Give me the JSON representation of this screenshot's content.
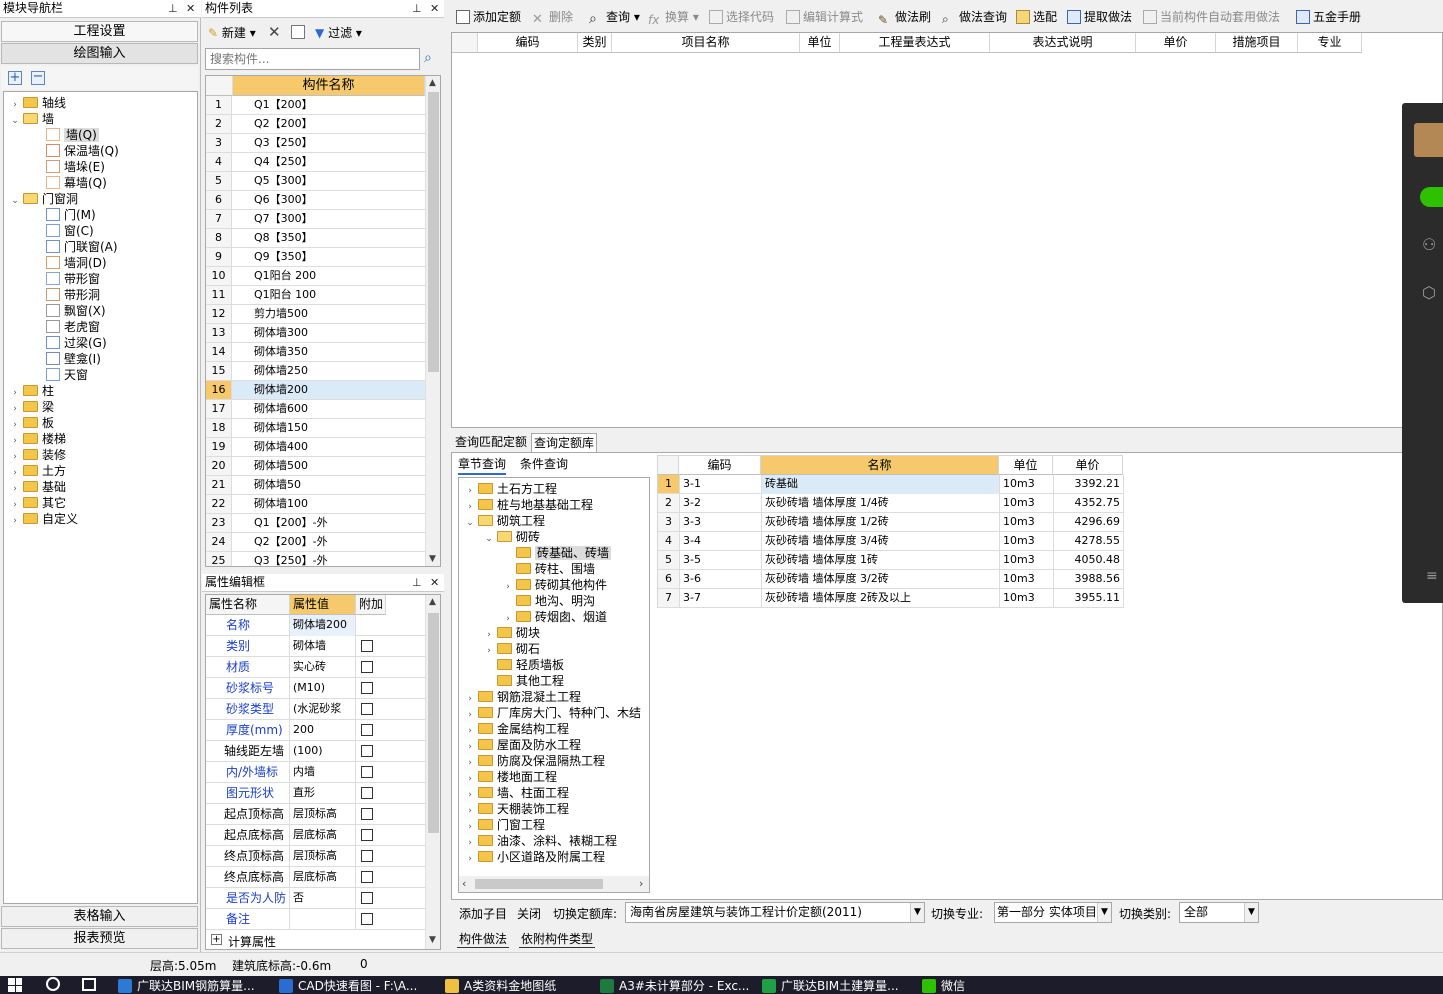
{
  "nav": {
    "title": "模块导航栏",
    "project_settings": "工程设置",
    "drawing_input": "绘图输入",
    "table_input": "表格输入",
    "report_preview": "报表预览",
    "tree": [
      {
        "label": "轴线",
        "level": 0,
        "arrow": "›",
        "open": false
      },
      {
        "label": "墙",
        "level": 0,
        "arrow": "⌄",
        "open": true
      },
      {
        "label": "墙(Q)",
        "level": 1,
        "icon": "wall",
        "selected": true
      },
      {
        "label": "保温墙(Q)",
        "level": 1,
        "icon": "insul"
      },
      {
        "label": "墙垛(E)",
        "level": 1,
        "icon": "pier"
      },
      {
        "label": "幕墙(Q)",
        "level": 1,
        "icon": "curtain"
      },
      {
        "label": "门窗洞",
        "level": 0,
        "arrow": "⌄",
        "open": true
      },
      {
        "label": "门(M)",
        "level": 1,
        "icon": "door"
      },
      {
        "label": "窗(C)",
        "level": 1,
        "icon": "window"
      },
      {
        "label": "门联窗(A)",
        "level": 1,
        "icon": "doorwin"
      },
      {
        "label": "墙洞(D)",
        "level": 1,
        "icon": "hole"
      },
      {
        "label": "带形窗",
        "level": 1,
        "icon": "stripwin"
      },
      {
        "label": "带形洞",
        "level": 1,
        "icon": "striphole"
      },
      {
        "label": "飘窗(X)",
        "level": 1,
        "icon": "baywin"
      },
      {
        "label": "老虎窗",
        "level": 1,
        "icon": "dormer"
      },
      {
        "label": "过梁(G)",
        "level": 1,
        "icon": "lintel"
      },
      {
        "label": "壁龛(I)",
        "level": 1,
        "icon": "niche"
      },
      {
        "label": "天窗",
        "level": 1,
        "icon": "skylight"
      },
      {
        "label": "柱",
        "level": 0,
        "arrow": "›"
      },
      {
        "label": "梁",
        "level": 0,
        "arrow": "›"
      },
      {
        "label": "板",
        "level": 0,
        "arrow": "›"
      },
      {
        "label": "楼梯",
        "level": 0,
        "arrow": "›"
      },
      {
        "label": "装修",
        "level": 0,
        "arrow": "›"
      },
      {
        "label": "土方",
        "level": 0,
        "arrow": "›"
      },
      {
        "label": "基础",
        "level": 0,
        "arrow": "›"
      },
      {
        "label": "其它",
        "level": 0,
        "arrow": "›"
      },
      {
        "label": "自定义",
        "level": 0,
        "arrow": "›"
      }
    ]
  },
  "component_list": {
    "title": "构件列表",
    "new_label": "新建",
    "filter_label": "过滤",
    "search_placeholder": "搜索构件...",
    "col_name": "构件名称",
    "rows": [
      "Q1【200】",
      "Q2【200】",
      "Q3【250】",
      "Q4【250】",
      "Q5【300】",
      "Q6【300】",
      "Q7【300】",
      "Q8【350】",
      "Q9【350】",
      "Q1阳台 200",
      "Q1阳台 100",
      "剪力墙500",
      "砌体墙300",
      "砌体墙350",
      "砌体墙250",
      "砌体墙200",
      "砌体墙600",
      "砌体墙150",
      "砌体墙400",
      "砌体墙500",
      "砌体墙50",
      "砌体墙100",
      "Q1【200】-外",
      "Q2【200】-外",
      "Q3【250】-外"
    ],
    "selected_index": 16
  },
  "properties": {
    "title": "属性编辑框",
    "col_name": "属性名称",
    "col_value": "属性值",
    "col_extra": "附加",
    "rows": [
      {
        "name": "名称",
        "value": "砌体墙200",
        "blue": true,
        "check": false
      },
      {
        "name": "类别",
        "value": "砌体墙",
        "blue": true,
        "check": true
      },
      {
        "name": "材质",
        "value": "实心砖",
        "blue": true,
        "check": true
      },
      {
        "name": "砂浆标号",
        "value": "(M10)",
        "blue": true,
        "check": true
      },
      {
        "name": "砂浆类型",
        "value": "(水泥砂浆",
        "blue": true,
        "check": true
      },
      {
        "name": "厚度(mm)",
        "value": "200",
        "blue": true,
        "check": true
      },
      {
        "name": "轴线距左墙",
        "value": "(100)",
        "blue": false,
        "check": true
      },
      {
        "name": "内/外墙标",
        "value": "内墙",
        "blue": true,
        "check": true
      },
      {
        "name": "图元形状",
        "value": "直形",
        "blue": true,
        "check": true
      },
      {
        "name": "起点顶标高",
        "value": "层顶标高",
        "blue": false,
        "check": true
      },
      {
        "name": "起点底标高",
        "value": "层底标高",
        "blue": false,
        "check": true
      },
      {
        "name": "终点顶标高",
        "value": "层顶标高",
        "blue": false,
        "check": true
      },
      {
        "name": "终点底标高",
        "value": "层底标高",
        "blue": false,
        "check": true
      },
      {
        "name": "是否为人防",
        "value": "否",
        "blue": true,
        "check": true
      },
      {
        "name": "备注",
        "value": "",
        "blue": true,
        "check": true
      }
    ],
    "calc_label": "计算属性"
  },
  "toolbar": {
    "add_quota": "添加定额",
    "delete": "删除",
    "query": "查询",
    "convert": "换算",
    "select_code": "选择代码",
    "edit_formula": "编辑计算式",
    "method_brush": "做法刷",
    "method_query": "做法查询",
    "select_match": "选配",
    "extract_method": "提取做法",
    "auto_apply": "当前构件自动套用做法",
    "hardware_manual": "五金手册"
  },
  "top_grid": {
    "headers": [
      "编码",
      "类别",
      "项目名称",
      "单位",
      "工程量表达式",
      "表达式说明",
      "单价",
      "措施项目",
      "专业"
    ]
  },
  "bottom_tabs": {
    "match_quota": "查询匹配定额",
    "quota_library": "查询定额库"
  },
  "sub_tabs": {
    "chapter": "章节查询",
    "condition": "条件查询"
  },
  "chapter_tree": [
    {
      "label": "土石方工程",
      "level": 0,
      "arrow": "›"
    },
    {
      "label": "桩与地基基础工程",
      "level": 0,
      "arrow": "›"
    },
    {
      "label": "砌筑工程",
      "level": 0,
      "arrow": "⌄",
      "open": true
    },
    {
      "label": "砌砖",
      "level": 1,
      "arrow": "⌄",
      "open": true
    },
    {
      "label": "砖基础、砖墙",
      "level": 2,
      "arrow": "",
      "selected": true
    },
    {
      "label": "砖柱、围墙",
      "level": 2,
      "arrow": ""
    },
    {
      "label": "砖砌其他构件",
      "level": 2,
      "arrow": "›"
    },
    {
      "label": "地沟、明沟",
      "level": 2,
      "arrow": ""
    },
    {
      "label": "砖烟囱、烟道",
      "level": 2,
      "arrow": "›"
    },
    {
      "label": "砌块",
      "level": 1,
      "arrow": "›"
    },
    {
      "label": "砌石",
      "level": 1,
      "arrow": "›"
    },
    {
      "label": "轻质墙板",
      "level": 1,
      "arrow": ""
    },
    {
      "label": "其他工程",
      "level": 1,
      "arrow": ""
    },
    {
      "label": "钢筋混凝土工程",
      "level": 0,
      "arrow": "›"
    },
    {
      "label": "厂库房大门、特种门、木结",
      "level": 0,
      "arrow": "›"
    },
    {
      "label": "金属结构工程",
      "level": 0,
      "arrow": "›"
    },
    {
      "label": "屋面及防水工程",
      "level": 0,
      "arrow": "›"
    },
    {
      "label": "防腐及保温隔热工程",
      "level": 0,
      "arrow": "›"
    },
    {
      "label": "楼地面工程",
      "level": 0,
      "arrow": "›"
    },
    {
      "label": "墙、柱面工程",
      "level": 0,
      "arrow": "›"
    },
    {
      "label": "天棚装饰工程",
      "level": 0,
      "arrow": "›"
    },
    {
      "label": "门窗工程",
      "level": 0,
      "arrow": "›"
    },
    {
      "label": "油漆、涂料、裱糊工程",
      "level": 0,
      "arrow": "›"
    },
    {
      "label": "小区道路及附属工程",
      "level": 0,
      "arrow": "›"
    }
  ],
  "quota_grid": {
    "headers": [
      "编码",
      "名称",
      "单位",
      "单价"
    ],
    "rows": [
      {
        "code": "3-1",
        "name": "砖基础",
        "unit": "10m3",
        "price": "3392.21"
      },
      {
        "code": "3-2",
        "name": "灰砂砖墙 墙体厚度 1/4砖",
        "unit": "10m3",
        "price": "4352.75"
      },
      {
        "code": "3-3",
        "name": "灰砂砖墙 墙体厚度 1/2砖",
        "unit": "10m3",
        "price": "4296.69"
      },
      {
        "code": "3-4",
        "name": "灰砂砖墙 墙体厚度 3/4砖",
        "unit": "10m3",
        "price": "4278.55"
      },
      {
        "code": "3-5",
        "name": "灰砂砖墙 墙体厚度 1砖",
        "unit": "10m3",
        "price": "4050.48"
      },
      {
        "code": "3-6",
        "name": "灰砂砖墙 墙体厚度 3/2砖",
        "unit": "10m3",
        "price": "3988.56"
      },
      {
        "code": "3-7",
        "name": "灰砂砖墙 墙体厚度 2砖及以上",
        "unit": "10m3",
        "price": "3955.11"
      }
    ]
  },
  "bottom_bar": {
    "add_child": "添加子目",
    "close": "关闭",
    "switch_library_label": "切换定额库:",
    "library_value": "海南省房屋建筑与装饰工程计价定额(2011)",
    "switch_major_label": "切换专业:",
    "major_value": "第一部分 实体项目",
    "switch_category_label": "切换类别:",
    "category_value": "全部"
  },
  "bottom_panel_tabs": {
    "method": "构件做法",
    "dependent": "依附构件类型"
  },
  "status": {
    "floor_height": "层高:5.05m",
    "bottom_elev": "建筑底标高:-0.6m",
    "value": "0"
  },
  "taskbar": [
    {
      "label": "广联达BIM钢筋算量...",
      "color": "#2d7ad6"
    },
    {
      "label": "CAD快速看图 - F:\\A...",
      "color": "#2b6cd0"
    },
    {
      "label": "A类资料金地图纸",
      "color": "#f0c040"
    },
    {
      "label": "A3#未计算部分 - Exc...",
      "color": "#1f7a3f"
    },
    {
      "label": "广联达BIM土建算量...",
      "color": "#1fa045"
    },
    {
      "label": "微信",
      "color": "#2dc100"
    }
  ]
}
